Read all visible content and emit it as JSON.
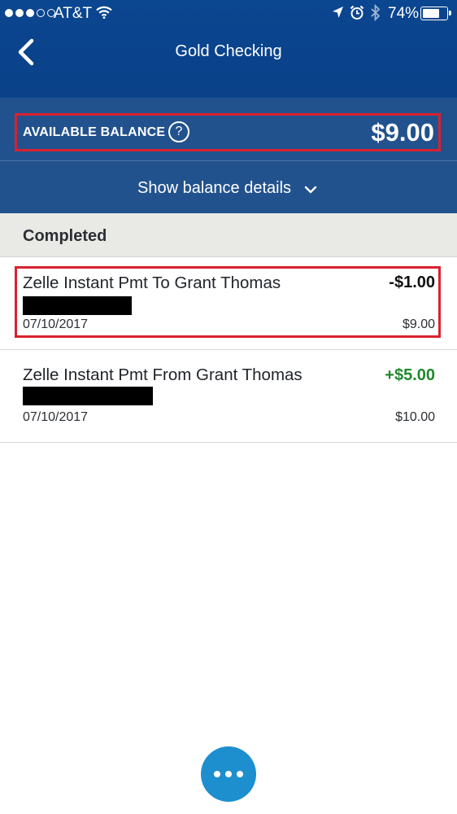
{
  "status_bar": {
    "signal_bars_filled": 3,
    "signal_bars_total": 5,
    "carrier": "AT&T",
    "wifi_icon": "wifi-icon",
    "location_icon": "location-arrow-icon",
    "alarm_icon": "alarm-clock-icon",
    "bluetooth_icon": "bluetooth-icon",
    "battery_percent": "74%",
    "battery_level": 0.74
  },
  "header": {
    "back_icon": "chevron-left-icon",
    "title": "Gold Checking",
    "background_color": "#0b4690"
  },
  "balance": {
    "label": "AVAILABLE BALANCE",
    "help_icon": "?",
    "amount": "$9.00",
    "details_toggle": "Show balance details",
    "details_icon": "chevron-down-icon",
    "background_color": "#22528e",
    "highlight_color": "#d9212f"
  },
  "section": {
    "title": "Completed"
  },
  "transactions": [
    {
      "description": "Zelle Instant Pmt To Grant Thomas",
      "amount": "-$1.00",
      "date": "07/10/2017",
      "running_balance": "$9.00",
      "amount_color": "#111111",
      "highlighted": true
    },
    {
      "description": "Zelle Instant Pmt From Grant Thomas",
      "amount": "+$5.00",
      "date": "07/10/2017",
      "running_balance": "$10.00",
      "amount_color": "#208a2c",
      "highlighted": false
    }
  ],
  "fab": {
    "icon": "more-horizontal-icon",
    "color": "#1d8fce"
  }
}
